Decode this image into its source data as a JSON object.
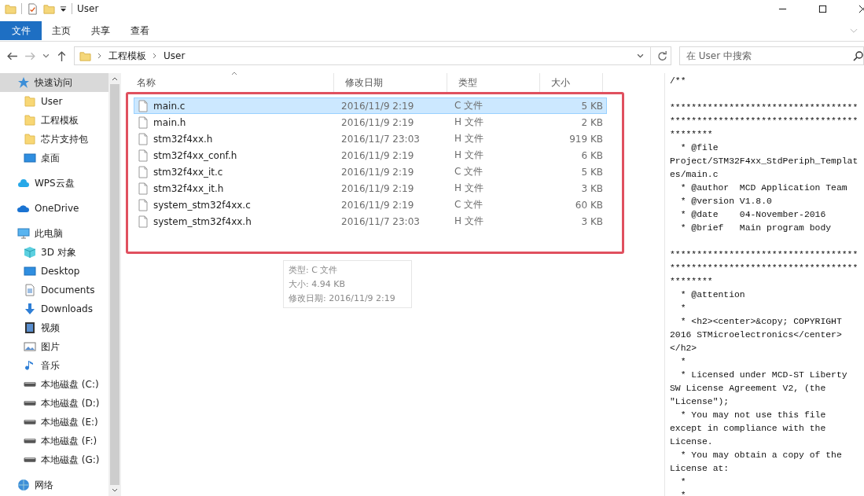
{
  "window": {
    "title": "User"
  },
  "ribbon": {
    "tabs": [
      {
        "label": "文件",
        "selected": true
      },
      {
        "label": "主页",
        "selected": false
      },
      {
        "label": "共享",
        "selected": false
      },
      {
        "label": "查看",
        "selected": false
      }
    ]
  },
  "address": {
    "path": [
      "工程模板",
      "User"
    ],
    "search_placeholder": "在 User 中搜索"
  },
  "nav": [
    {
      "label": "快速访问",
      "kind": "star",
      "selected": true,
      "children": [
        {
          "label": "User",
          "kind": "folder",
          "selected": false
        },
        {
          "label": "工程模板",
          "kind": "folder",
          "selected": false
        },
        {
          "label": "芯片支持包",
          "kind": "folder",
          "selected": false
        },
        {
          "label": "桌面",
          "kind": "desktop",
          "selected": false
        }
      ]
    },
    {
      "label": "WPS云盘",
      "kind": "cloudlight",
      "selected": false
    },
    {
      "label": "OneDrive",
      "kind": "cloud",
      "selected": false
    },
    {
      "label": "此电脑",
      "kind": "pc",
      "selected": false,
      "children": [
        {
          "label": "3D 对象",
          "kind": "cube",
          "selected": false
        },
        {
          "label": "Desktop",
          "kind": "desktop",
          "selected": false
        },
        {
          "label": "Documents",
          "kind": "doc",
          "selected": false
        },
        {
          "label": "Downloads",
          "kind": "download",
          "selected": false
        },
        {
          "label": "视频",
          "kind": "video",
          "selected": false
        },
        {
          "label": "图片",
          "kind": "picture",
          "selected": false
        },
        {
          "label": "音乐",
          "kind": "music",
          "selected": false
        },
        {
          "label": "本地磁盘 (C:)",
          "kind": "drive",
          "selected": false
        },
        {
          "label": "本地磁盘 (D:)",
          "kind": "drive",
          "selected": false
        },
        {
          "label": "本地磁盘 (E:)",
          "kind": "drive",
          "selected": false
        },
        {
          "label": "本地磁盘 (F:)",
          "kind": "drive",
          "selected": false
        },
        {
          "label": "本地磁盘 (G:)",
          "kind": "drive",
          "selected": false
        }
      ]
    },
    {
      "label": "网络",
      "kind": "globe",
      "selected": false
    }
  ],
  "table": {
    "columns": [
      "名称",
      "修改日期",
      "类型",
      "大小"
    ],
    "rows": [
      {
        "name": "main.c",
        "date": "2016/11/9 2:19",
        "type": "C 文件",
        "size": "5 KB",
        "selected": true
      },
      {
        "name": "main.h",
        "date": "2016/11/9 2:19",
        "type": "H 文件",
        "size": "2 KB",
        "selected": false
      },
      {
        "name": "stm32f4xx.h",
        "date": "2016/11/7 23:03",
        "type": "H 文件",
        "size": "919 KB",
        "selected": false
      },
      {
        "name": "stm32f4xx_conf.h",
        "date": "2016/11/9 2:19",
        "type": "H 文件",
        "size": "6 KB",
        "selected": false
      },
      {
        "name": "stm32f4xx_it.c",
        "date": "2016/11/9 2:19",
        "type": "C 文件",
        "size": "5 KB",
        "selected": false
      },
      {
        "name": "stm32f4xx_it.h",
        "date": "2016/11/9 2:19",
        "type": "H 文件",
        "size": "3 KB",
        "selected": false
      },
      {
        "name": "system_stm32f4xx.c",
        "date": "2016/11/9 2:19",
        "type": "C 文件",
        "size": "60 KB",
        "selected": false
      },
      {
        "name": "system_stm32f4xx.h",
        "date": "2016/11/7 23:03",
        "type": "H 文件",
        "size": "3 KB",
        "selected": false
      }
    ]
  },
  "tooltip": [
    "类型: C 文件",
    "大小: 4.94 KB",
    "修改日期: 2016/11/9 2:19"
  ],
  "preview": [
    [
      "/**"
    ],
    [
      "***********************************",
      "***********************************",
      "********",
      "  * @file",
      "Project/STM32F4xx_StdPeriph_Templat",
      "es/main.c",
      "  * @author  MCD Application Team",
      "  * @version V1.8.0",
      "  * @date    04-November-2016",
      "  * @brief   Main program body"
    ],
    [
      "***********************************",
      "***********************************",
      "********",
      "  * @attention",
      "  *",
      "  * <h2><center>&copy; COPYRIGHT",
      "2016 STMicroelectronics</center>",
      "</h2>",
      "  *",
      "  * Licensed under MCD-ST Liberty",
      "SW License Agreement V2, (the",
      "\"License\");",
      "  * You may not use this file",
      "except in compliance with the",
      "License.",
      "  * You may obtain a copy of the",
      "License at:",
      "  *",
      "  *"
    ]
  ]
}
